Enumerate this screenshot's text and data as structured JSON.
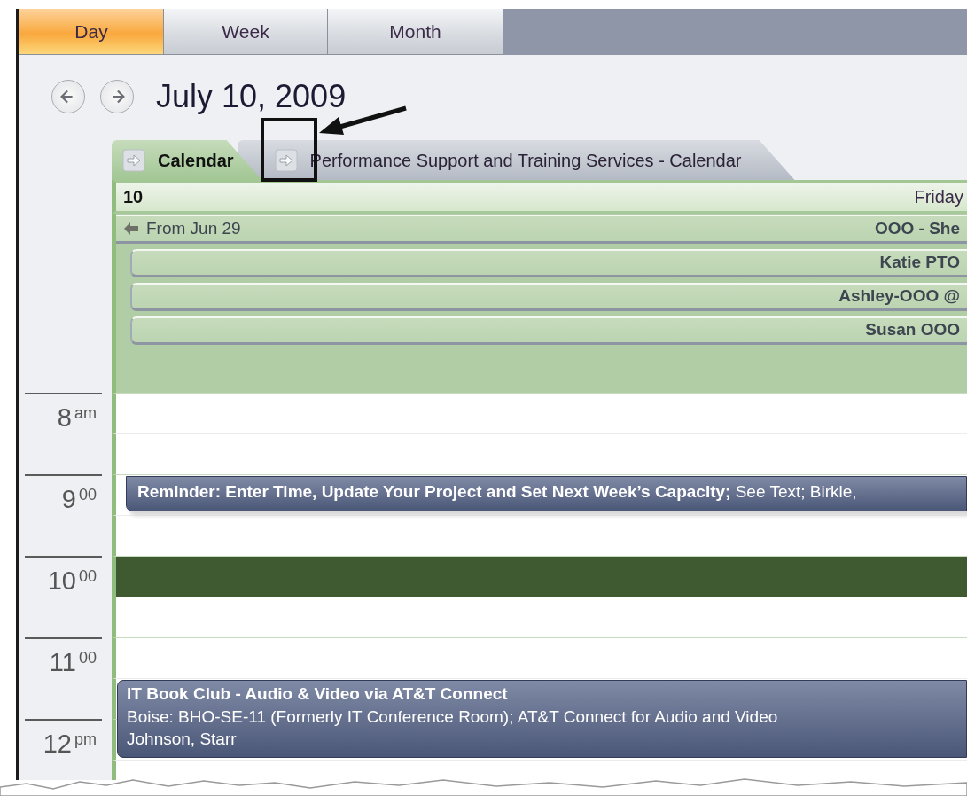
{
  "view_tabs": [
    {
      "label": "Day",
      "selected": true
    },
    {
      "label": "Week",
      "selected": false
    },
    {
      "label": "Month",
      "selected": false
    }
  ],
  "date_title": "July 10, 2009",
  "calendar_tabs": [
    {
      "label": "Calendar",
      "selected": true
    },
    {
      "label": "Performance Support and Training Services - Calendar",
      "selected": false
    }
  ],
  "day_header": {
    "day_number": "10",
    "weekday": "Friday"
  },
  "all_day_events": [
    {
      "kind": "continued",
      "from_label": "From Jun 29",
      "title": "OOO - She"
    },
    {
      "kind": "event",
      "title": "Katie PTO"
    },
    {
      "kind": "event",
      "title": "Ashley-OOO @"
    },
    {
      "kind": "event",
      "title": "Susan OOO"
    }
  ],
  "time_slots": [
    {
      "hour": "8",
      "suffix": "am",
      "half_hours": [
        {
          "selected": false
        },
        {
          "selected": false
        }
      ]
    },
    {
      "hour": "9",
      "suffix": "00",
      "half_hours": [
        {
          "selected": false,
          "appointment": {
            "kind": "reminder",
            "lines": [
              "**Reminder:  Enter Time, Update Your Project and Set Next Week’s Capacity;** See Text; Birkle,"
            ]
          }
        },
        {
          "selected": false
        }
      ]
    },
    {
      "hour": "10",
      "suffix": "00",
      "half_hours": [
        {
          "selected": true
        },
        {
          "selected": false
        }
      ]
    },
    {
      "hour": "11",
      "suffix": "00",
      "half_hours": [
        {
          "selected": false
        },
        {
          "selected": false,
          "appointment": {
            "kind": "meeting",
            "lines": [
              "**IT Book Club - Audio & Video via AT&T Connect**",
              "Boise:  BHO-SE-11 (Formerly IT Conference Room); AT&T Connect for Audio and Video",
              "Johnson, Starr"
            ]
          }
        }
      ]
    },
    {
      "hour": "12",
      "suffix": "pm",
      "half_hours": [
        {
          "selected": false
        },
        {
          "selected": false
        }
      ]
    }
  ]
}
